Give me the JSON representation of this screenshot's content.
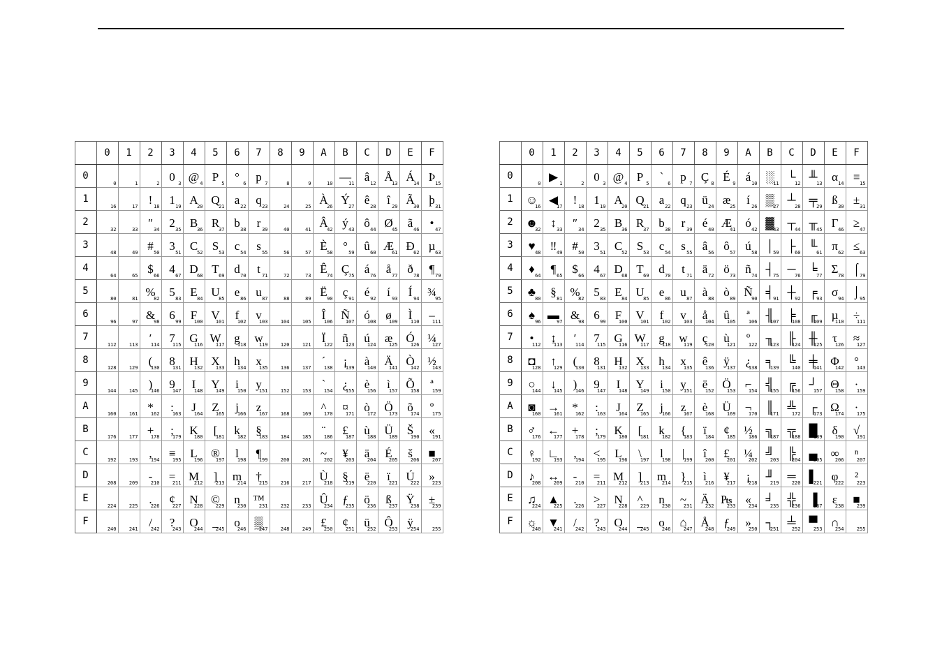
{
  "columns": [
    "0",
    "1",
    "2",
    "3",
    "4",
    "5",
    "6",
    "7",
    "8",
    "9",
    "A",
    "B",
    "C",
    "D",
    "E",
    "F"
  ],
  "rows": [
    "0",
    "1",
    "2",
    "3",
    "4",
    "5",
    "6",
    "7",
    "8",
    "9",
    "A",
    "B",
    "C",
    "D",
    "E",
    "F"
  ],
  "note": "Two 16×16 code-page tables. Each cell has the glyph and the decimal code (row*16 + col). Table 1 ≈ Windows-1252 / Latin-1 style. Table 2 ≈ IBM Code Page 437 style.",
  "chart_data": [
    {
      "type": "table",
      "title": "Extended ASCII table (Latin-1 / Windows-1252 variant)",
      "columns_hex": [
        "0",
        "1",
        "2",
        "3",
        "4",
        "5",
        "6",
        "7",
        "8",
        "9",
        "A",
        "B",
        "C",
        "D",
        "E",
        "F"
      ],
      "rows_hex": [
        "0",
        "1",
        "2",
        "3",
        "4",
        "5",
        "6",
        "7",
        "8",
        "9",
        "A",
        "B",
        "C",
        "D",
        "E",
        "F"
      ],
      "grid_glyphs": [
        [
          "",
          "",
          "",
          "0",
          "@",
          "P",
          "°",
          "p",
          "",
          "",
          "",
          "—",
          "â",
          "Å",
          "Á",
          "Þ"
        ],
        [
          "",
          "",
          "!",
          "1",
          "A",
          "Q",
          "a",
          "q",
          "",
          "",
          "À",
          "Ý",
          "ê",
          "î",
          "Ã",
          "þ"
        ],
        [
          "",
          "",
          "″",
          "2",
          "B",
          "R",
          "b",
          "r",
          "",
          "",
          "Â",
          "ý",
          "ô",
          "Ø",
          "ã",
          "•"
        ],
        [
          "",
          "",
          "#",
          "3",
          "C",
          "S",
          "c",
          "s",
          "",
          "",
          "È",
          "°",
          "û",
          "Æ",
          "Ð",
          "µ"
        ],
        [
          "",
          "",
          "$",
          "4",
          "D",
          "T",
          "d",
          "t",
          "",
          "",
          "Ê",
          "Ç",
          "á",
          "å",
          "ð",
          "¶"
        ],
        [
          "",
          "",
          "%",
          "5",
          "E",
          "U",
          "e",
          "u",
          "",
          "",
          "Ë",
          "ç",
          "é",
          "í",
          "Í",
          "¾"
        ],
        [
          "",
          "",
          "&",
          "6",
          "F",
          "V",
          "f",
          "v",
          "",
          "",
          "Î",
          "Ñ",
          "ó",
          "ø",
          "Ì",
          "–"
        ],
        [
          "",
          "",
          "′",
          "7",
          "G",
          "W",
          "g",
          "w",
          "",
          "",
          "Ï",
          "ñ",
          "ú",
          "æ",
          "Ó",
          "¼"
        ],
        [
          "",
          "",
          "(",
          "8",
          "H",
          "X",
          "h",
          "x",
          "",
          "",
          "´",
          "¡",
          "à",
          "Ä",
          "Ò",
          "½"
        ],
        [
          "",
          "",
          ")",
          "9",
          "I",
          "Y",
          "i",
          "y",
          "",
          "",
          "`",
          "¿",
          "è",
          "ì",
          "Õ",
          "ª"
        ],
        [
          "",
          "",
          "*",
          ":",
          "J",
          "Z",
          "j",
          "z",
          "",
          "",
          "^",
          "¤",
          "ò",
          "Ö",
          "õ",
          "º"
        ],
        [
          "",
          "",
          "+",
          ";",
          "K",
          "[",
          "k",
          "§",
          "",
          "",
          "¨",
          "£",
          "ù",
          "Ü",
          "Š",
          "«"
        ],
        [
          "",
          "",
          ",",
          "≡",
          "L",
          "®",
          "l",
          "¶",
          "",
          "",
          "~",
          "¥",
          "ä",
          "É",
          "š",
          "■"
        ],
        [
          "",
          "",
          "-",
          "=",
          "M",
          "]",
          "m",
          "†",
          "",
          "",
          "Ù",
          "§",
          "ë",
          "ï",
          "Ú",
          "»"
        ],
        [
          "",
          "",
          ".",
          "¢",
          "N",
          "©",
          "n",
          "™",
          "",
          "",
          "Û",
          "ƒ",
          "ö",
          "ß",
          "Ÿ",
          "±"
        ],
        [
          "",
          "",
          "/",
          "?",
          "O",
          "_",
          "o",
          "▒",
          "",
          "",
          "£",
          "¢",
          "ü",
          "Ô",
          "ÿ",
          ""
        ]
      ],
      "decimal_base": 0
    },
    {
      "type": "table",
      "title": "Extended ASCII table (IBM PC / CP437 variant)",
      "columns_hex": [
        "0",
        "1",
        "2",
        "3",
        "4",
        "5",
        "6",
        "7",
        "8",
        "9",
        "A",
        "B",
        "C",
        "D",
        "E",
        "F"
      ],
      "rows_hex": [
        "0",
        "1",
        "2",
        "3",
        "4",
        "5",
        "6",
        "7",
        "8",
        "9",
        "A",
        "B",
        "C",
        "D",
        "E",
        "F"
      ],
      "grid_glyphs": [
        [
          "",
          "▶",
          "",
          "0",
          "@",
          "P",
          "`",
          "p",
          "Ç",
          "É",
          "á",
          "░",
          "└",
          "╨",
          "α",
          "≡"
        ],
        [
          "☺",
          "◀",
          "!",
          "1",
          "A",
          "Q",
          "a",
          "q",
          "ü",
          "æ",
          "í",
          "▒",
          "┴",
          "╤",
          "ß",
          "±"
        ],
        [
          "☻",
          "↕",
          "″",
          "2",
          "B",
          "R",
          "b",
          "r",
          "é",
          "Æ",
          "ó",
          "▓",
          "┬",
          "╥",
          "Γ",
          "≥"
        ],
        [
          "♥",
          "‼",
          "#",
          "3",
          "C",
          "S",
          "c",
          "s",
          "â",
          "ô",
          "ú",
          "│",
          "├",
          "╙",
          "π",
          "≤"
        ],
        [
          "♦",
          "¶",
          "$",
          "4",
          "D",
          "T",
          "d",
          "t",
          "ä",
          "ö",
          "ñ",
          "┤",
          "─",
          "╘",
          "Σ",
          "⌠"
        ],
        [
          "♣",
          "§",
          "%",
          "5",
          "E",
          "U",
          "e",
          "u",
          "à",
          "ò",
          "Ñ",
          "╡",
          "┼",
          "╒",
          "σ",
          "⌡"
        ],
        [
          "♠",
          "▬",
          "&",
          "6",
          "F",
          "V",
          "f",
          "v",
          "å",
          "û",
          "ª",
          "╢",
          "╞",
          "╓",
          "µ",
          "÷"
        ],
        [
          "•",
          "↨",
          "′",
          "7",
          "G",
          "W",
          "g",
          "w",
          "ç",
          "ù",
          "º",
          "╖",
          "╟",
          "╫",
          "τ",
          "≈"
        ],
        [
          "◘",
          "↑",
          "(",
          "8",
          "H",
          "X",
          "h",
          "x",
          "ê",
          "ÿ",
          "¿",
          "╕",
          "╚",
          "╪",
          "Φ",
          "°"
        ],
        [
          "○",
          "↓",
          ")",
          "9",
          "I",
          "Y",
          "i",
          "y",
          "ë",
          "Ö",
          "⌐",
          "╣",
          "╔",
          "┘",
          "Θ",
          "·"
        ],
        [
          "◙",
          "→",
          "*",
          ":",
          "J",
          "Z",
          "j",
          "z",
          "è",
          "Ü",
          "¬",
          "║",
          "╩",
          "┌",
          "Ω",
          "·"
        ],
        [
          "♂",
          "←",
          "+",
          ";",
          "K",
          "[",
          "k",
          "{",
          "ï",
          "¢",
          "½",
          "╗",
          "╦",
          "█",
          "δ",
          "√"
        ],
        [
          "♀",
          "∟",
          ",",
          "<",
          "L",
          "\\",
          "l",
          "|",
          "î",
          "£",
          "¼",
          "╝",
          "╠",
          "▄",
          "∞",
          "ⁿ"
        ],
        [
          "♪",
          "↔",
          "-",
          "=",
          "M",
          "]",
          "m",
          "}",
          "ì",
          "¥",
          "¡",
          "╜",
          "═",
          "▌",
          "φ",
          "²"
        ],
        [
          "♫",
          "▲",
          ".",
          ">",
          "N",
          "^",
          "n",
          "~",
          "Ä",
          "₧",
          "«",
          "╛",
          "╬",
          "▐",
          "ε",
          "■"
        ],
        [
          "☼",
          "▼",
          "/",
          "?",
          "O",
          "_",
          "o",
          "⌂",
          "Å",
          "ƒ",
          "»",
          "┐",
          "╧",
          "▀",
          "∩",
          ""
        ]
      ],
      "decimal_base": 0
    }
  ]
}
